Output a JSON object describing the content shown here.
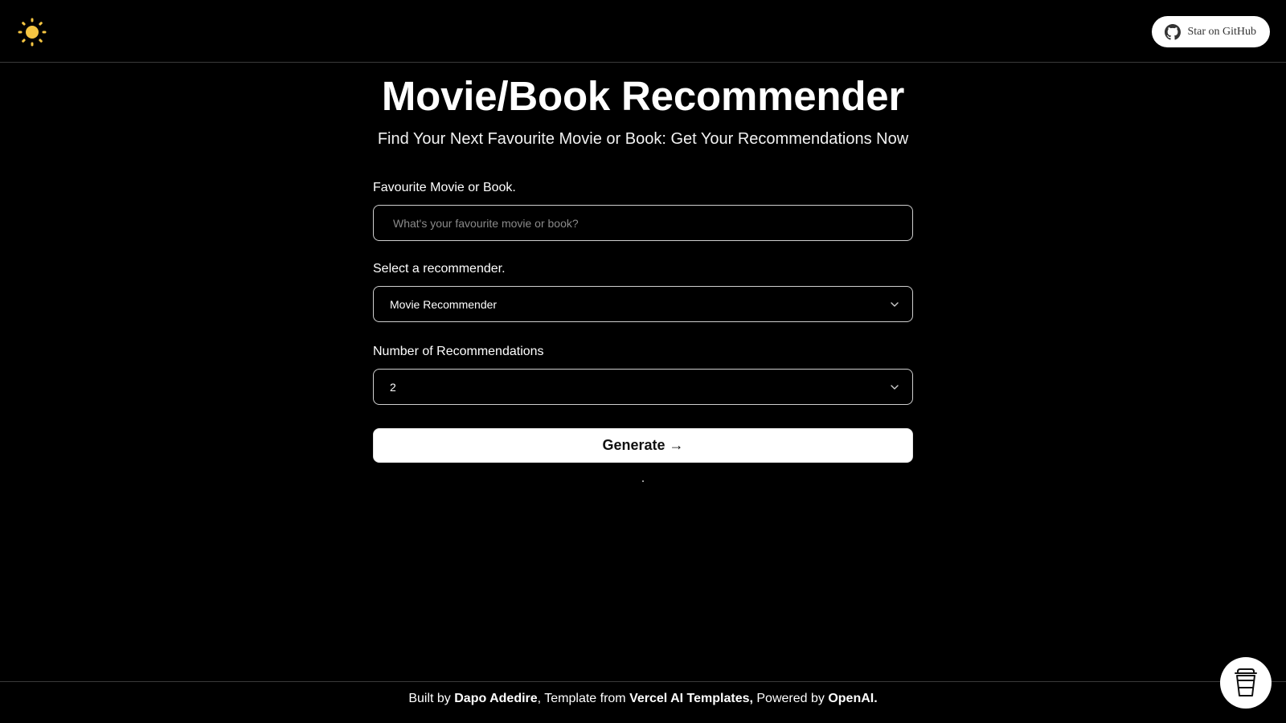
{
  "header": {
    "theme_icon": "sun-icon",
    "github_button": {
      "icon": "github-icon",
      "label": "Star on GitHub"
    }
  },
  "main": {
    "title": "Movie/Book Recommender",
    "subtitle": "Find Your Next Favourite Movie or Book: Get Your Recommendations Now",
    "form": {
      "favourite": {
        "label": "Favourite Movie or Book.",
        "placeholder": "What's your favourite movie or book?",
        "value": ""
      },
      "recommender": {
        "label": "Select a recommender.",
        "selected": "Movie Recommender"
      },
      "count": {
        "label": "Number of Recommendations",
        "selected": "2"
      },
      "generate_label": "Generate →"
    }
  },
  "footer": {
    "prefix": "Built by ",
    "author": "Dapo Adedire",
    "mid1": ", Template from ",
    "template": "Vercel AI Templates,",
    "mid2": " Powered by ",
    "powered": "OpenAI."
  },
  "floating": {
    "icon": "coffee-cup-icon"
  },
  "colors": {
    "background": "#000000",
    "text": "#ffffff",
    "sun": "#f5c542",
    "border": "#3a3a3a"
  }
}
